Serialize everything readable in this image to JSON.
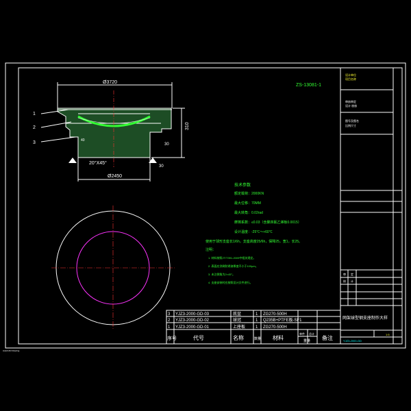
{
  "drawing_code": "ZS-13081-1",
  "dims": {
    "top_width": "Ø3720",
    "height": "310",
    "bottom_width": "Ø2450",
    "chamfer": "20°X45°",
    "step_height": "30",
    "small_dim": "30",
    "left_small": "40"
  },
  "leaders": [
    "1",
    "2",
    "3"
  ],
  "tech_req": {
    "title": "技术参数",
    "lines": [
      "额定载荷：2000KN",
      "最大位移：70MM",
      "最大转角：0.02rad",
      "摩擦系数：≤0.03（含聚四氟乙烯板0.0015）",
      "设计温度：-25℃～+60℃",
      "使用于球形支座长1/6h，支座高度25/6h，保障25，宽1，长25。"
    ]
  },
  "notes": {
    "title": "注明：",
    "lines": [
      "1. 材料按照JT/T391-2009中相关规定。",
      "2. 表面应涂刷防锈漆厚度不小于100μm。",
      "3. 未注倒角为2×45°。",
      "4. 支座安装时应按照设计文件进行。"
    ]
  },
  "bom": {
    "rows": [
      {
        "no": "3",
        "code": "YJZ3-2000-GD-03",
        "name": "底盆",
        "qty": "1",
        "mat": "ZG270-500H"
      },
      {
        "no": "2",
        "code": "YJZ3-2000-GD-02",
        "name": "球冠",
        "qty": "1",
        "mat": "Q235B+PTFE板-SF1"
      },
      {
        "no": "1",
        "code": "YJZ3-2000-GD-01",
        "name": "上座板",
        "qty": "1",
        "mat": "ZG270-500H"
      }
    ],
    "header": {
      "no": "序号",
      "code": "代号",
      "name": "名称",
      "qty": "数量",
      "mat": "材料",
      "w1": "单件",
      "w2": "总计",
      "weight": "重量",
      "remark": "备注"
    }
  },
  "title_block": {
    "top_small": [
      "设计单位",
      "项目名称"
    ],
    "mid_small": [
      "审核审定",
      "设计 校核"
    ],
    "lower_small": [
      "图号及图名",
      "比例尺寸"
    ],
    "right_tags": [
      "审",
      "定",
      "核",
      "计"
    ],
    "title": "网架球型钢支座制作大样",
    "scale": "1:5",
    "sheet": "YJZ3-2000-GD"
  },
  "status_text": "AutoCAD Drawing"
}
